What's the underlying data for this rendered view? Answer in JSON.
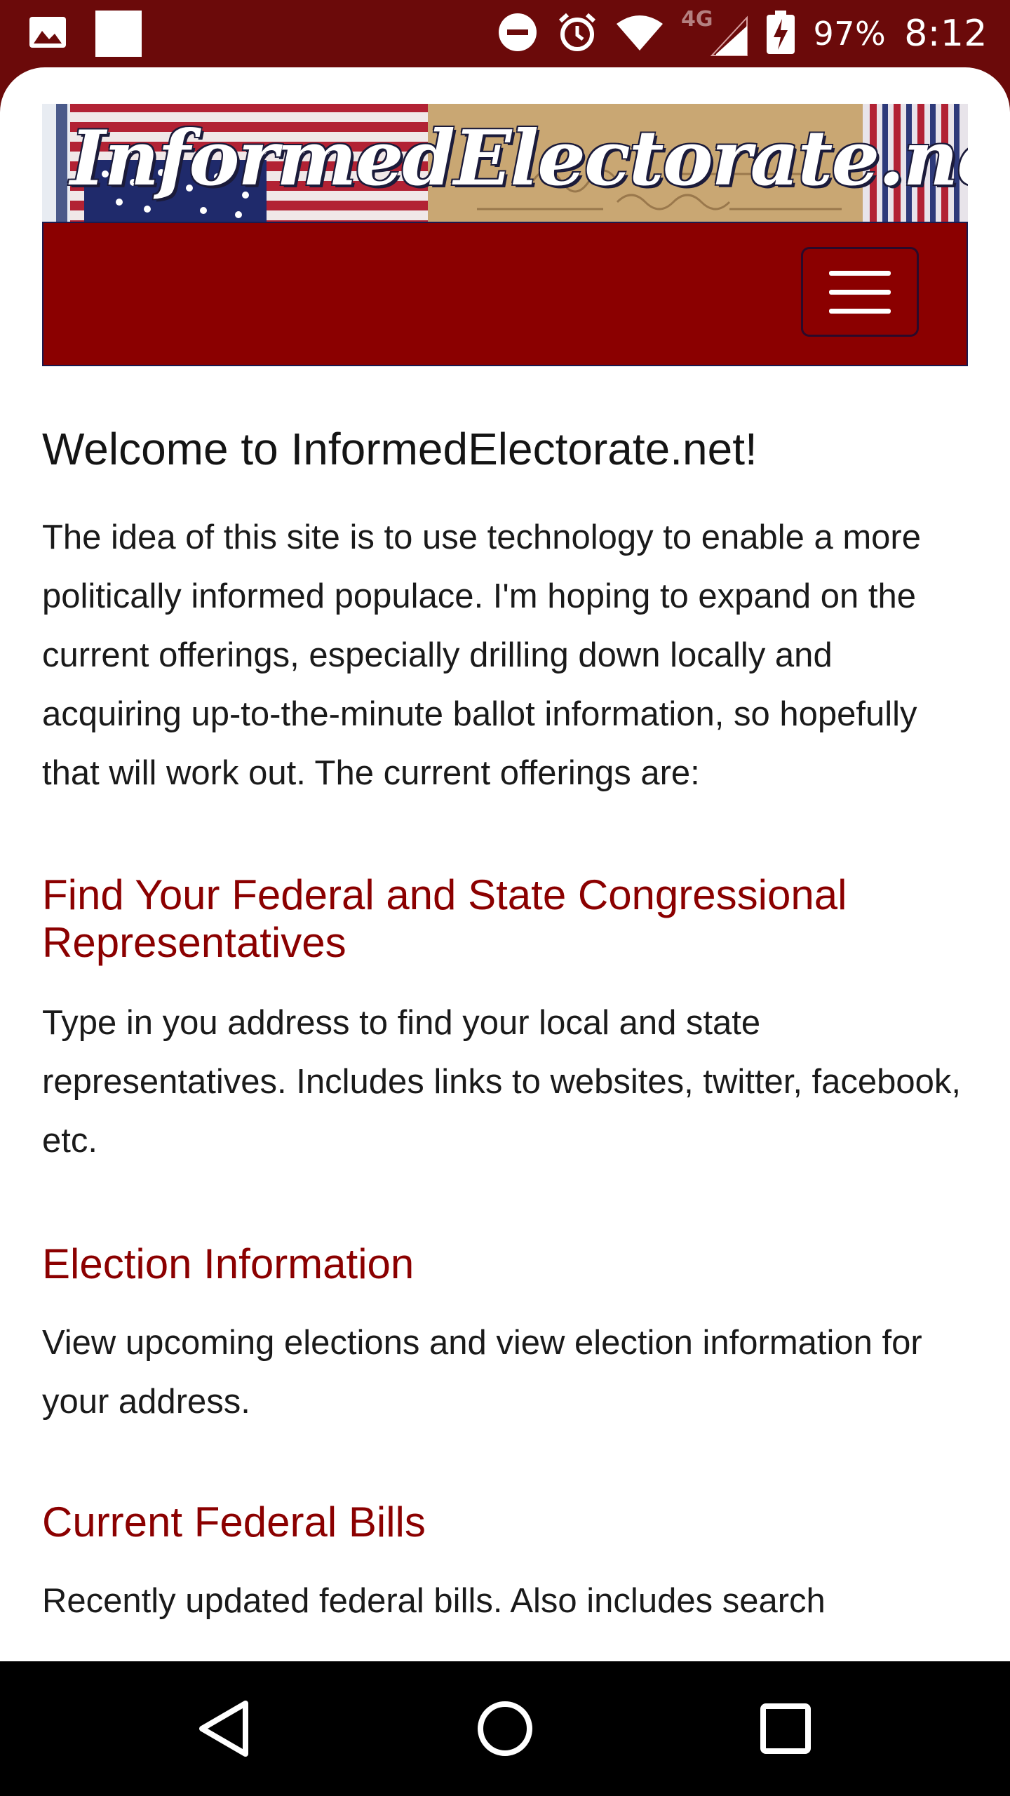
{
  "status_bar": {
    "battery": "97%",
    "time": "8:12",
    "network": "4G",
    "icons": [
      "image-icon",
      "white-square-icon",
      "do-not-disturb-icon",
      "alarm-icon",
      "wifi-icon",
      "signal-icon",
      "battery-charging-icon"
    ]
  },
  "site": {
    "banner_title": "InformedElectorate.net",
    "menu_icon": "hamburger-menu-icon"
  },
  "main": {
    "title": "Welcome to InformedElectorate.net!",
    "intro": "The idea of this site is to use technology to enable a more politically informed populace. I'm hoping to expand on the current offerings, especially drilling down locally and acquiring up-to-the-minute ballot information, so hopefully that will work out. The current offerings are:",
    "sections": [
      {
        "heading": "Find Your Federal and State Congressional Representatives",
        "text": "Type in you address to find your local and state representatives. Includes links to websites, twitter, facebook, etc."
      },
      {
        "heading": "Election Information",
        "text": "View upcoming elections and view election information for your address."
      },
      {
        "heading": "Current Federal Bills",
        "text": "Recently updated federal bills. Also includes search"
      }
    ]
  },
  "nav_bar": {
    "buttons": [
      "back-icon",
      "home-icon",
      "recents-icon"
    ]
  },
  "colors": {
    "status_bar": "#6b0a0a",
    "navbar": "#8b0000",
    "heading": "#8b0000",
    "text": "#1a1a1a"
  }
}
